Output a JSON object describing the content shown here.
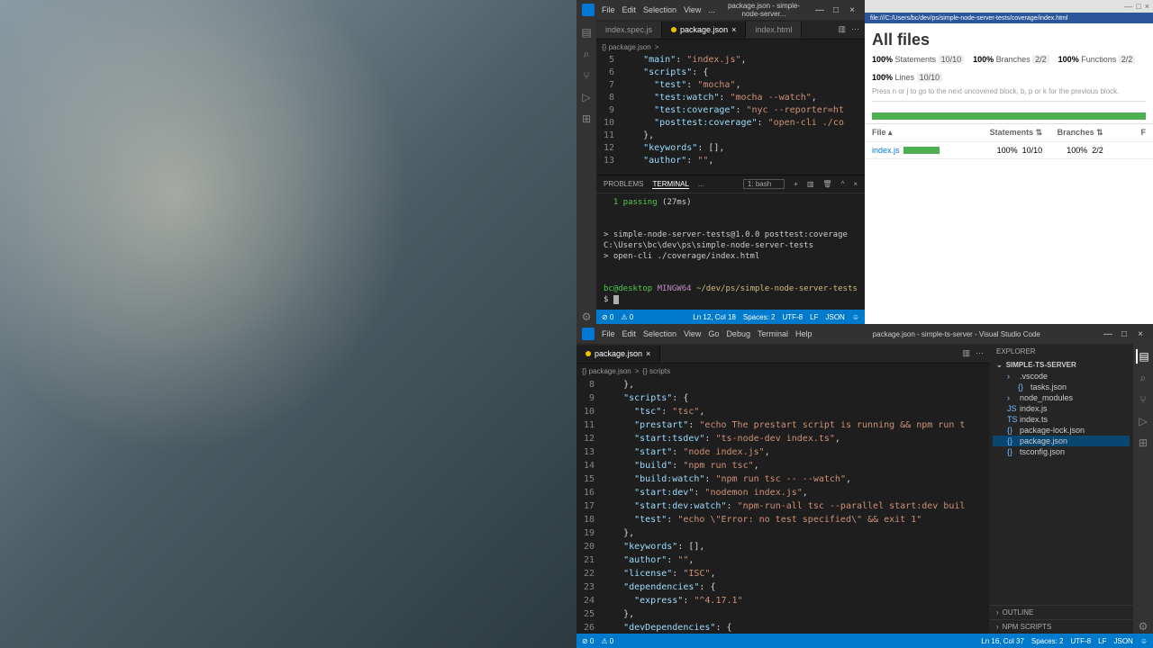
{
  "vscode_top": {
    "menus": [
      "File",
      "Edit",
      "Selection",
      "View",
      "..."
    ],
    "wintitle": "package.json - simple-node-server...",
    "winctrl": {
      "min": "—",
      "max": "□",
      "close": "×"
    },
    "tabs": [
      {
        "label": "index.spec.js",
        "active": false
      },
      {
        "label": "package.json",
        "active": true
      },
      {
        "label": "index.html",
        "active": false
      }
    ],
    "breadcrumb": [
      "{} package.json",
      ">"
    ],
    "code": [
      {
        "n": 5,
        "html": "    <span class='tok-key'>\"main\"</span><span class='tok-pun'>:</span> <span class='tok-str'>\"index.js\"</span><span class='tok-pun'>,</span>"
      },
      {
        "n": 6,
        "html": "    <span class='tok-key'>\"scripts\"</span><span class='tok-pun'>:</span> <span class='tok-pun'>{</span>"
      },
      {
        "n": 7,
        "html": "      <span class='tok-key'>\"test\"</span><span class='tok-pun'>:</span> <span class='tok-str'>\"mocha\"</span><span class='tok-pun'>,</span>"
      },
      {
        "n": 8,
        "html": "      <span class='tok-key'>\"test:watch\"</span><span class='tok-pun'>:</span> <span class='tok-str'>\"mocha --watch\"</span><span class='tok-pun'>,</span>"
      },
      {
        "n": 9,
        "html": "      <span class='tok-key'>\"test:coverage\"</span><span class='tok-pun'>:</span> <span class='tok-str'>\"nyc --reporter=ht</span>"
      },
      {
        "n": 10,
        "html": "      <span class='tok-key'>\"posttest:coverage\"</span><span class='tok-pun'>:</span> <span class='tok-str'>\"open-cli ./co</span>"
      },
      {
        "n": 11,
        "html": "    <span class='tok-pun'>},</span>"
      },
      {
        "n": 12,
        "html": "    <span class='tok-key'>\"keywords\"</span><span class='tok-pun'>:</span> <span class='tok-pun'>[],</span>"
      },
      {
        "n": 13,
        "html": "    <span class='tok-key'>\"author\"</span><span class='tok-pun'>:</span> <span class='tok-str'>\"\"</span><span class='tok-pun'>,</span>"
      }
    ],
    "panel": {
      "tabs": [
        "PROBLEMS",
        "TERMINAL",
        "..."
      ],
      "active": "TERMINAL",
      "shell": "1: bash",
      "lines": [
        "  <span class='term-green'>1 passing</span> (27ms)",
        "",
        "",
        "> simple-node-server-tests@1.0.0 posttest:coverage C:\\Users\\bc\\dev\\ps\\simple-node-server-tests",
        "> open-cli ./coverage/index.html",
        "",
        "",
        "<span class='term-green'>bc@desktop</span> <span class='term-purple'>MINGW64</span> <span class='term-yellow'>~/dev/ps/simple-node-server-tests</span>",
        "$ "
      ]
    },
    "status": {
      "left": [
        "⊘ 0",
        "⚠ 0"
      ],
      "right": [
        "Ln 12, Col 18",
        "Spaces: 2",
        "UTF-8",
        "LF",
        "JSON",
        "☺"
      ]
    }
  },
  "coverage": {
    "addr": "file:///C:/Users/bc/dev/ps/simple-node-server-tests/coverage/index.html",
    "title": "All files",
    "stats": [
      {
        "pct": "100%",
        "label": "Statements",
        "ratio": "10/10"
      },
      {
        "pct": "100%",
        "label": "Branches",
        "ratio": "2/2"
      },
      {
        "pct": "100%",
        "label": "Functions",
        "ratio": "2/2"
      },
      {
        "pct": "100%",
        "label": "Lines",
        "ratio": "10/10"
      }
    ],
    "hint": "Press n or j to go to the next uncovered block, b, p or k for the previous block.",
    "headers": {
      "file": "File ▴",
      "stat": "Statements ⇅",
      "br": "Branches ⇅",
      "fn": "F"
    },
    "rows": [
      {
        "file": "index.js",
        "stat_pct": "100%",
        "stat_ratio": "10/10",
        "br_pct": "100%",
        "br_ratio": "2/2"
      }
    ]
  },
  "vscode_bot": {
    "menus": [
      "File",
      "Edit",
      "Selection",
      "View",
      "Go",
      "Debug",
      "Terminal",
      "Help"
    ],
    "wintitle": "package.json - simple-ts-server - Visual Studio Code",
    "winctrl": {
      "min": "—",
      "max": "□",
      "close": "×"
    },
    "tabs": [
      {
        "label": "package.json",
        "active": true
      }
    ],
    "breadcrumb": [
      "{} package.json",
      ">",
      "{} scripts"
    ],
    "code": [
      {
        "n": 8,
        "html": "    <span class='tok-pun'>},</span>"
      },
      {
        "n": 9,
        "html": "    <span class='tok-key'>\"scripts\"</span><span class='tok-pun'>:</span> <span class='tok-pun'>{</span>"
      },
      {
        "n": 10,
        "html": "      <span class='tok-key'>\"tsc\"</span><span class='tok-pun'>:</span> <span class='tok-str'>\"tsc\"</span><span class='tok-pun'>,</span>"
      },
      {
        "n": 11,
        "html": "      <span class='tok-key'>\"prestart\"</span><span class='tok-pun'>:</span> <span class='tok-str'>\"echo The prestart script is running && npm run t</span>"
      },
      {
        "n": 12,
        "html": "      <span class='tok-key'>\"start:tsdev\"</span><span class='tok-pun'>:</span> <span class='tok-str'>\"ts-node-dev index.ts\"</span><span class='tok-pun'>,</span>"
      },
      {
        "n": 13,
        "html": "      <span class='tok-key'>\"start\"</span><span class='tok-pun'>:</span> <span class='tok-str'>\"node index.js\"</span><span class='tok-pun'>,</span>"
      },
      {
        "n": 14,
        "html": "      <span class='tok-key'>\"build\"</span><span class='tok-pun'>:</span> <span class='tok-str'>\"npm run tsc\"</span><span class='tok-pun'>,</span>"
      },
      {
        "n": 15,
        "html": "      <span class='tok-key'>\"build:watch\"</span><span class='tok-pun'>:</span> <span class='tok-str'>\"npm run tsc -- --watch\"</span><span class='tok-pun'>,</span>"
      },
      {
        "n": 16,
        "html": "      <span class='tok-key'>\"start:dev\"</span><span class='tok-pun'>:</span> <span class='tok-str'>\"nodemon index.js\"</span><span class='tok-pun'>,</span>"
      },
      {
        "n": 17,
        "html": "      <span class='tok-key'>\"start:dev:watch\"</span><span class='tok-pun'>:</span> <span class='tok-str'>\"npm-run-all tsc --parallel start:dev buil</span>"
      },
      {
        "n": 18,
        "html": "      <span class='tok-key'>\"test\"</span><span class='tok-pun'>:</span> <span class='tok-str'>\"echo \\\"Error: no test specified\\\" && exit 1\"</span>"
      },
      {
        "n": 19,
        "html": "    <span class='tok-pun'>},</span>"
      },
      {
        "n": 20,
        "html": "    <span class='tok-key'>\"keywords\"</span><span class='tok-pun'>:</span> <span class='tok-pun'>[],</span>"
      },
      {
        "n": 21,
        "html": "    <span class='tok-key'>\"author\"</span><span class='tok-pun'>:</span> <span class='tok-str'>\"\"</span><span class='tok-pun'>,</span>"
      },
      {
        "n": 22,
        "html": "    <span class='tok-key'>\"license\"</span><span class='tok-pun'>:</span> <span class='tok-str'>\"ISC\"</span><span class='tok-pun'>,</span>"
      },
      {
        "n": 23,
        "html": "    <span class='tok-key'>\"dependencies\"</span><span class='tok-pun'>:</span> <span class='tok-pun'>{</span>"
      },
      {
        "n": 24,
        "html": "      <span class='tok-key'>\"express\"</span><span class='tok-pun'>:</span> <span class='tok-str'>\"^4.17.1\"</span>"
      },
      {
        "n": 25,
        "html": "    <span class='tok-pun'>},</span>"
      },
      {
        "n": 26,
        "html": "    <span class='tok-key'>\"devDependencies\"</span><span class='tok-pun'>:</span> <span class='tok-pun'>{</span>"
      }
    ],
    "sidebar": {
      "title": "EXPLORER",
      "proj": "SIMPLE-TS-SERVER",
      "tree": [
        {
          "label": ".vscode",
          "icon": "›",
          "indent": 0
        },
        {
          "label": "tasks.json",
          "icon": "{}",
          "indent": 1
        },
        {
          "label": "node_modules",
          "icon": "›",
          "indent": 0
        },
        {
          "label": "index.js",
          "icon": "JS",
          "indent": 0
        },
        {
          "label": "index.ts",
          "icon": "TS",
          "indent": 0
        },
        {
          "label": "package-lock.json",
          "icon": "{}",
          "indent": 0
        },
        {
          "label": "package.json",
          "icon": "{}",
          "indent": 0,
          "sel": true
        },
        {
          "label": "tsconfig.json",
          "icon": "{}",
          "indent": 0
        }
      ],
      "sections": [
        "OUTLINE",
        "NPM SCRIPTS"
      ]
    },
    "status": {
      "left": [
        "⊘ 0",
        "⚠ 0"
      ],
      "right": [
        "Ln 16, Col 37",
        "Spaces: 2",
        "UTF-8",
        "LF",
        "JSON",
        "☺"
      ]
    }
  }
}
